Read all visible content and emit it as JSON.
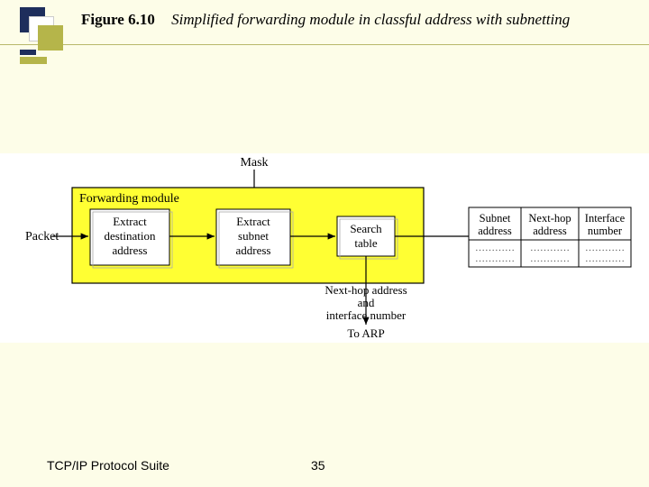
{
  "header": {
    "figure_num": "Figure 6.10",
    "caption": "Simplified forwarding module in classful address with subnetting"
  },
  "diagram": {
    "mask_label": "Mask",
    "module_label": "Forwarding module",
    "packet_label": "Packet",
    "box1_l1": "Extract",
    "box1_l2": "destination",
    "box1_l3": "address",
    "box2_l1": "Extract",
    "box2_l2": "subnet",
    "box2_l3": "address",
    "box3_l1": "Search",
    "box3_l2": "table",
    "nexthop_l1": "Next-hop address",
    "nexthop_l2": "and",
    "nexthop_l3": "interface number",
    "to_arp": "To ARP",
    "table": {
      "col1_l1": "Subnet",
      "col1_l2": "address",
      "col2_l1": "Next-hop",
      "col2_l2": "address",
      "col3_l1": "Interface",
      "col3_l2": "number",
      "dots": "…………"
    }
  },
  "footer": {
    "suite": "TCP/IP Protocol Suite",
    "page": "35"
  }
}
